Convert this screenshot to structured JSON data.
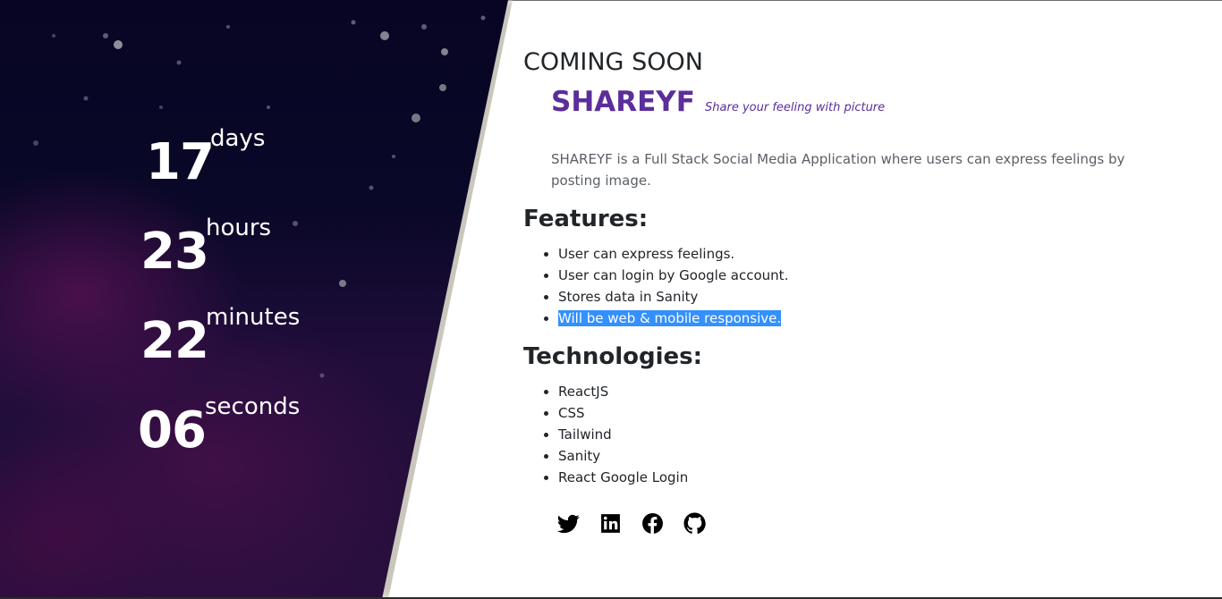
{
  "countdown": [
    {
      "value": "17",
      "unit": "days"
    },
    {
      "value": "23",
      "unit": "hours"
    },
    {
      "value": "22",
      "unit": "minutes"
    },
    {
      "value": "06",
      "unit": "seconds"
    }
  ],
  "heading": "COMING SOON",
  "brand": {
    "name": "SHAREYF",
    "tagline": "Share your feeling with picture"
  },
  "description": "SHAREYF is a Full Stack Social Media Application where users can express feelings by posting image.",
  "features": {
    "title": "Features:",
    "items": [
      "User can express feelings.",
      "User can login by Google account.",
      "Stores data in Sanity",
      "Will be web & mobile responsive."
    ]
  },
  "technologies": {
    "title": "Technologies:",
    "items": [
      "ReactJS",
      "CSS",
      "Tailwind",
      "Sanity",
      "React Google Login"
    ]
  },
  "social_icons": [
    "twitter-icon",
    "linkedin-icon",
    "facebook-icon",
    "github-icon"
  ],
  "colors": {
    "brand": "#5b2e9a",
    "panel_dark": "#070523",
    "panel_purple": "#2a0f3e",
    "selection": "#3390ff"
  }
}
